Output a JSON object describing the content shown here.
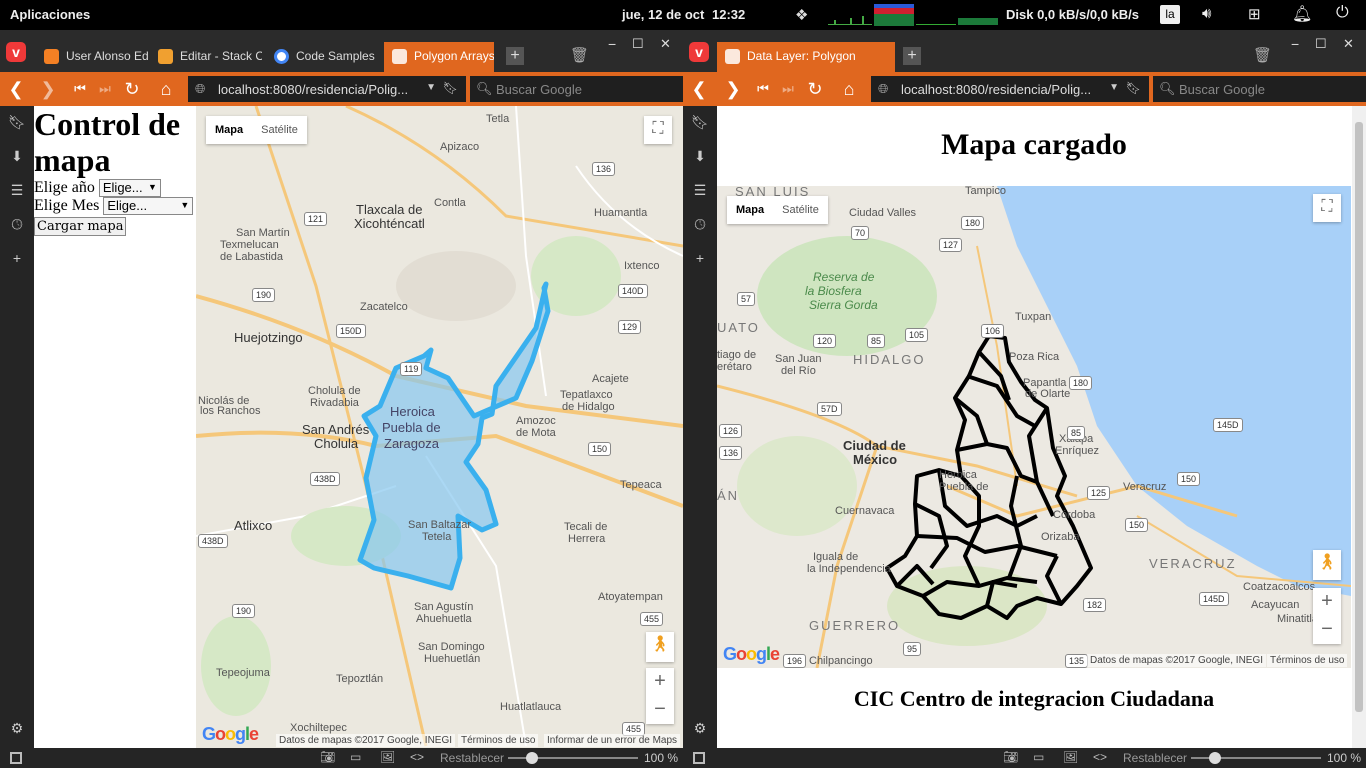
{
  "system_bar": {
    "apps_label": "Aplicaciones",
    "date": "jue, 12 de oct",
    "time": "12:32",
    "disk": "Disk 0,0 kB/s/0,0 kB/s",
    "keyboard": "la"
  },
  "left_window": {
    "tabs": [
      {
        "label": "User Alonso Edu",
        "color": "#f48024"
      },
      {
        "label": "Editar - Stack O",
        "color": "#f0a030"
      },
      {
        "label": "Code Samples",
        "color": "#4285f4"
      },
      {
        "label": "Polygon Arrays",
        "color": "#e0671f"
      }
    ],
    "url": "localhost:8080/residencia/Polig...",
    "search_placeholder": "Buscar Google",
    "page": {
      "heading": "Control de mapa",
      "year_label": "Elige año",
      "year_select": "Elige...",
      "month_label": "Elige Mes",
      "month_select": "Elige...",
      "load_button": "Cargar mapa"
    },
    "map": {
      "type_map": "Mapa",
      "type_satellite": "Satélite",
      "footer_data": "Datos de mapas ©2017 Google, INEGI",
      "footer_terms": "Términos de uso",
      "footer_report": "Informar de un error de Maps",
      "labels": [
        "Tetla",
        "Apizaco",
        "Tlaxcala de",
        "Xicohténcatl",
        "Contla",
        "Huamantla",
        "San Martín",
        "Texmelucan",
        "de Labastida",
        "Ixtenco",
        "Zacatelco",
        "Huejotzingo",
        "Acajete",
        "Cholula de",
        "Rivadabia",
        "Tepatlaxco",
        "de Hidalgo",
        "Nicolás de",
        "los Ranchos",
        "San Andrés",
        "Cholula",
        "Heroica",
        "Puebla de",
        "Zaragoza",
        "Amozoc",
        "de Mota",
        "Tepeaca",
        "Atlixco",
        "San Baltazar",
        "Tetela",
        "Tecali de",
        "Herrera",
        "Atoyatempan",
        "San Agustín",
        "Ahuehuetla",
        "Tepeojuma",
        "San Domingo",
        "Huehuetlán",
        "Tepoztlán",
        "Huatlatlauca",
        "Xochiltepec"
      ],
      "shields": [
        "136",
        "121",
        "140D",
        "129",
        "190",
        "150D",
        "119",
        "150",
        "438D",
        "438D",
        "190",
        "455",
        "455"
      ]
    },
    "status": {
      "reset": "Restablecer",
      "zoom": "100 %"
    }
  },
  "right_window": {
    "tab": {
      "label": "Data Layer: Polygon",
      "color": "#e0671f"
    },
    "url": "localhost:8080/residencia/Polig...",
    "search_placeholder": "Buscar Google",
    "page": {
      "title": "Mapa cargado",
      "footer": "CIC Centro de integracion Ciudadana"
    },
    "map": {
      "type_map": "Mapa",
      "type_satellite": "Satélite",
      "footer_data": "Datos de mapas ©2017 Google, INEGI",
      "footer_terms": "Términos de uso",
      "labels": [
        "SAN LUIS",
        "Tampico",
        "Ciudad Valles",
        "Reserva de",
        "la Biosfera",
        "Sierra Gorda",
        "Tuxpan",
        "UATO",
        "HIDALGO",
        "Poza Rica",
        "Papantla",
        "de Olarte",
        "San Juan",
        "del Río",
        "tiago de",
        "erétaro",
        "Xalapa",
        "Enríquez",
        "Ciudad de",
        "México",
        "Veracruz",
        "Heroica",
        "Puebla de",
        "ÁN",
        "Cuernavaca",
        "Córdoba",
        "Orizaba",
        "Iguala de",
        "la Independencia",
        "VERACRUZ",
        "Coatzacoalcos",
        "Acayucan",
        "Minatitlá",
        "GUERRERO",
        "Chilpancingo"
      ],
      "shields": [
        "180",
        "70",
        "127",
        "57",
        "105",
        "106",
        "120",
        "85",
        "180",
        "57D",
        "126",
        "136",
        "150",
        "125",
        "150",
        "145D",
        "182",
        "196",
        "135",
        "95",
        "145D",
        "85"
      ]
    },
    "status": {
      "reset": "Restablecer",
      "zoom": "100 %"
    }
  }
}
